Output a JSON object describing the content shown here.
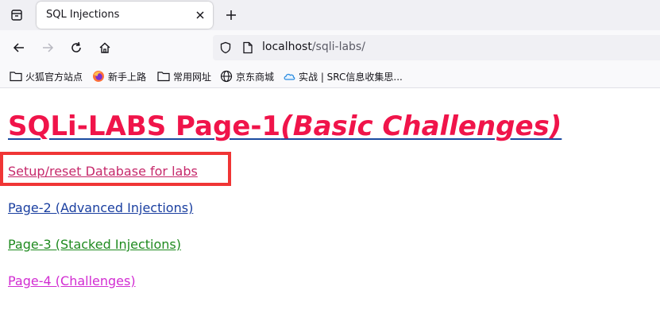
{
  "tab": {
    "title": "SQL Injections"
  },
  "address_bar": {
    "host": "localhost",
    "path": "/sqli-labs/"
  },
  "bookmarks": [
    {
      "label": "火狐官方站点",
      "icon": "folder-icon"
    },
    {
      "label": "新手上路",
      "icon": "firefox-icon"
    },
    {
      "label": "常用网址",
      "icon": "folder-icon"
    },
    {
      "label": "京东商城",
      "icon": "globe-icon"
    },
    {
      "label": "实战 | SRC信息收集思...",
      "icon": "cloud-icon"
    }
  ],
  "page": {
    "heading_main": "SQLi-LABS Page-1",
    "heading_sub": "(Basic Challenges)",
    "links": [
      {
        "label": "Setup/reset Database for labs"
      },
      {
        "label": "Page-2 (Advanced Injections)"
      },
      {
        "label": "Page-3 (Stacked Injections)"
      },
      {
        "label": "Page-4 (Challenges)"
      }
    ]
  },
  "colors": {
    "heading": "#f0144a",
    "underline": "#1a4aa0",
    "link_setup": "#c6296b",
    "link_page2": "#1a3fa0",
    "link_page3": "#1f8a1f",
    "link_page4": "#d22cd2",
    "highlight_box": "#f03535"
  }
}
